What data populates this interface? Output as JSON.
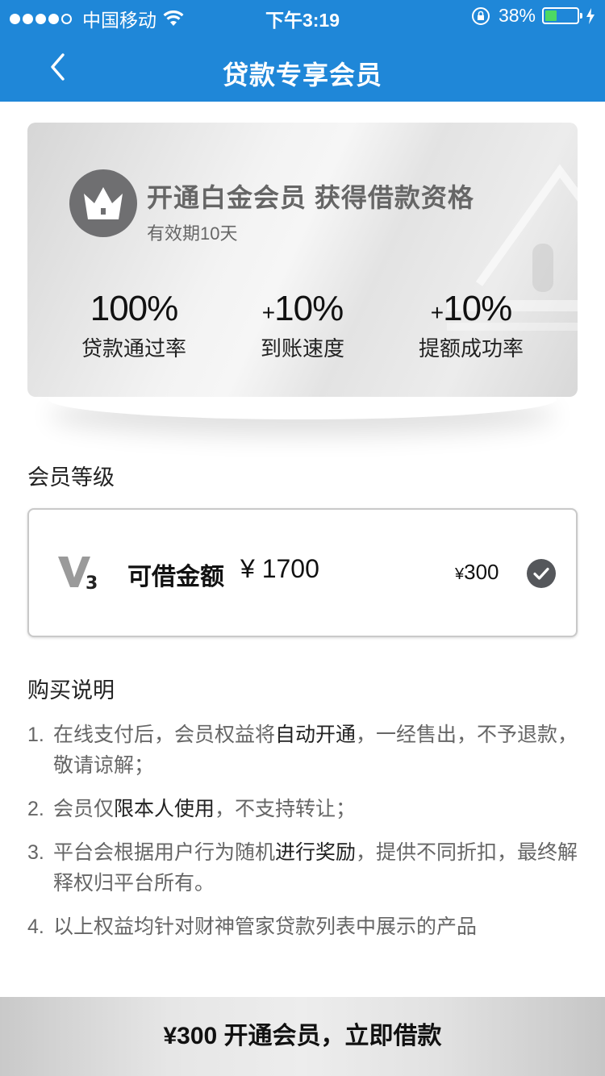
{
  "status_bar": {
    "carrier": "中国移动",
    "time": "下午3:19",
    "battery_pct_label": "38%",
    "battery_level": 0.38,
    "battery_color": "#4cd964"
  },
  "nav": {
    "back_icon": "chevron-left-icon",
    "title": "贷款专享会员",
    "bg_color": "#1f87d8"
  },
  "card": {
    "badge_icon": "crown-icon",
    "title": "开通白金会员 获得借款资格",
    "subtitle": "有效期10天",
    "stats": [
      {
        "prefix": "",
        "value": "100%",
        "label": "贷款通过率"
      },
      {
        "prefix": "+",
        "value": "10%",
        "label": "到账速度"
      },
      {
        "prefix": "+",
        "value": "10%",
        "label": "提额成功率"
      }
    ]
  },
  "level_section": {
    "title": "会员等级",
    "option": {
      "badge_icon": "v3-icon",
      "label": "可借金额",
      "amount": "¥ 1700",
      "price_symbol": "¥",
      "price": "300",
      "selected": true
    }
  },
  "notes_section": {
    "title": "购买说明",
    "items": [
      {
        "num": "1.",
        "pre": "在线支付后，会员权益将",
        "hl": "自动开通",
        "post": "，一经售出，不予退款，敬请谅解；"
      },
      {
        "num": "2.",
        "pre": " 会员仅",
        "hl": "限本人使用",
        "post": "，不支持转让；"
      },
      {
        "num": "3.",
        "pre": "平台会根据用户行为随机",
        "hl": "进行奖励",
        "post": "，提供不同折扣，最终解释权归平台所有。"
      },
      {
        "num": "4.",
        "pre": " 以上权益均针对财神管家贷款列表中展示的产品",
        "hl": "",
        "post": ""
      }
    ]
  },
  "bottom_button": {
    "label": "¥300 开通会员，立即借款"
  }
}
